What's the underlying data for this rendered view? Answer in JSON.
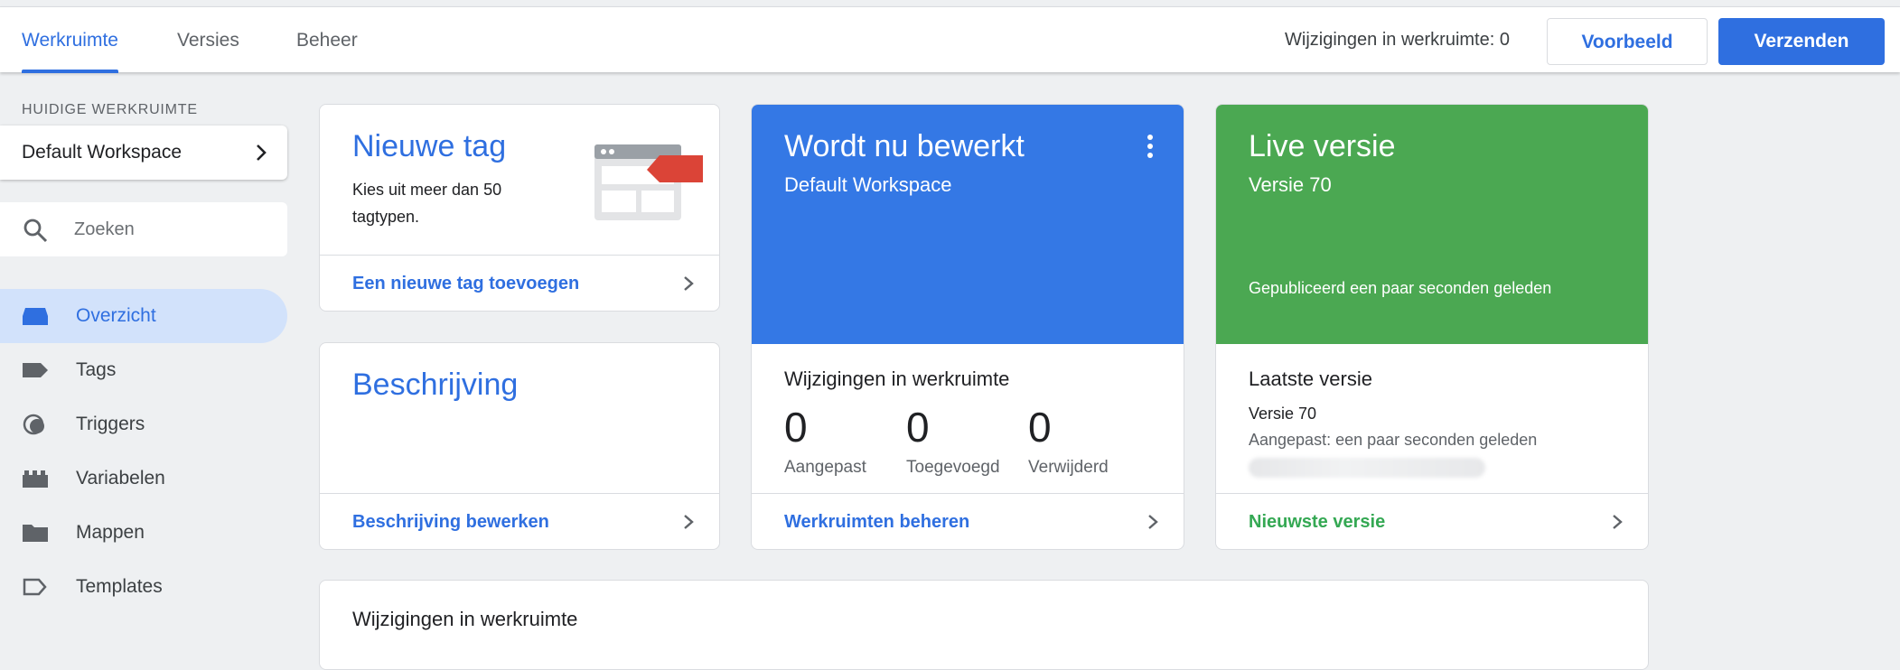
{
  "tabs": [
    {
      "label": "Werkruimte",
      "active": true
    },
    {
      "label": "Versies",
      "active": false
    },
    {
      "label": "Beheer",
      "active": false
    }
  ],
  "topbar": {
    "changes_text": "Wijzigingen in werkruimte: 0",
    "preview_label": "Voorbeeld",
    "submit_label": "Verzenden"
  },
  "sidebar": {
    "workspace_heading": "HUIDIGE WERKRUIMTE",
    "workspace_name": "Default Workspace",
    "search_placeholder": "Zoeken",
    "items": [
      {
        "label": "Overzicht",
        "icon": "overview-icon",
        "active": true
      },
      {
        "label": "Tags",
        "icon": "tag-icon",
        "active": false
      },
      {
        "label": "Triggers",
        "icon": "trigger-icon",
        "active": false
      },
      {
        "label": "Variabelen",
        "icon": "variables-icon",
        "active": false
      },
      {
        "label": "Mappen",
        "icon": "folder-icon",
        "active": false
      },
      {
        "label": "Templates",
        "icon": "template-icon",
        "active": false
      }
    ]
  },
  "new_tag_card": {
    "title": "Nieuwe tag",
    "description_line1": "Kies uit meer dan 50",
    "description_line2": "tagtypen.",
    "link": "Een nieuwe tag toevoegen"
  },
  "description_card": {
    "title": "Beschrijving",
    "link": "Beschrijving bewerken"
  },
  "editing_card": {
    "title": "Wordt nu bewerkt",
    "subtitle": "Default Workspace",
    "changes_heading": "Wijzigingen in werkruimte",
    "stats": [
      {
        "value": "0",
        "label": "Aangepast"
      },
      {
        "value": "0",
        "label": "Toegevoegd"
      },
      {
        "value": "0",
        "label": "Verwijderd"
      }
    ],
    "link": "Werkruimten beheren"
  },
  "live_card": {
    "title": "Live versie",
    "subtitle": "Versie 70",
    "published_text": "Gepubliceerd een paar seconden geleden",
    "latest_heading": "Laatste versie",
    "latest_version": "Versie 70",
    "modified_text": "Aangepast: een paar seconden geleden",
    "link": "Nieuwste versie"
  },
  "bottom_card": {
    "title": "Wijzigingen in werkruimte"
  },
  "colors": {
    "accent_blue": "#2f6fe0",
    "editing_card_bg": "#3478e5",
    "live_card_bg": "#4ba852",
    "link_green": "#34a853"
  }
}
